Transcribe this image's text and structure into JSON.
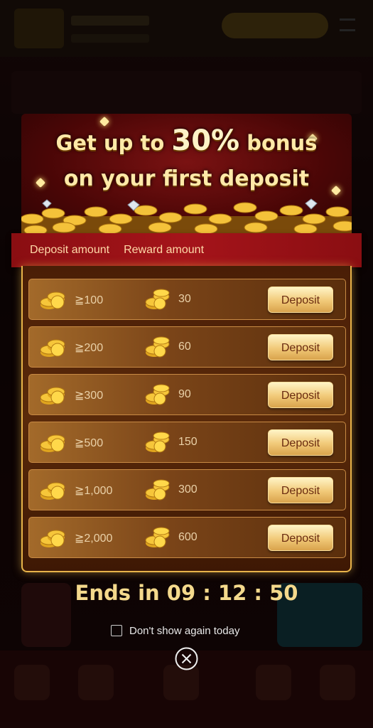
{
  "promo": {
    "headline_line1_pre": "Get up to ",
    "headline_highlight": "30%",
    "headline_line1_post": " bonus",
    "headline_line2": "on your first deposit"
  },
  "table_header": {
    "deposit_label": "Deposit amount",
    "reward_label": "Reward amount"
  },
  "rows": [
    {
      "min": "≧100",
      "reward": "30",
      "button": "Deposit"
    },
    {
      "min": "≧200",
      "reward": "60",
      "button": "Deposit"
    },
    {
      "min": "≧300",
      "reward": "90",
      "button": "Deposit"
    },
    {
      "min": "≧500",
      "reward": "150",
      "button": "Deposit"
    },
    {
      "min": "≧1,000",
      "reward": "300",
      "button": "Deposit"
    },
    {
      "min": "≧2,000",
      "reward": "600",
      "button": "Deposit"
    }
  ],
  "timer": {
    "text": "Ends in 09 : 12 : 50"
  },
  "dont_show": {
    "label": "Don't show again today",
    "checked": false
  },
  "colors": {
    "accent_gold": "#e8b44a",
    "header_red": "#a5141a",
    "button_gold": "#f1c978"
  },
  "icons": {
    "coin": "coin-stack-icon",
    "close": "close-circle-icon"
  }
}
